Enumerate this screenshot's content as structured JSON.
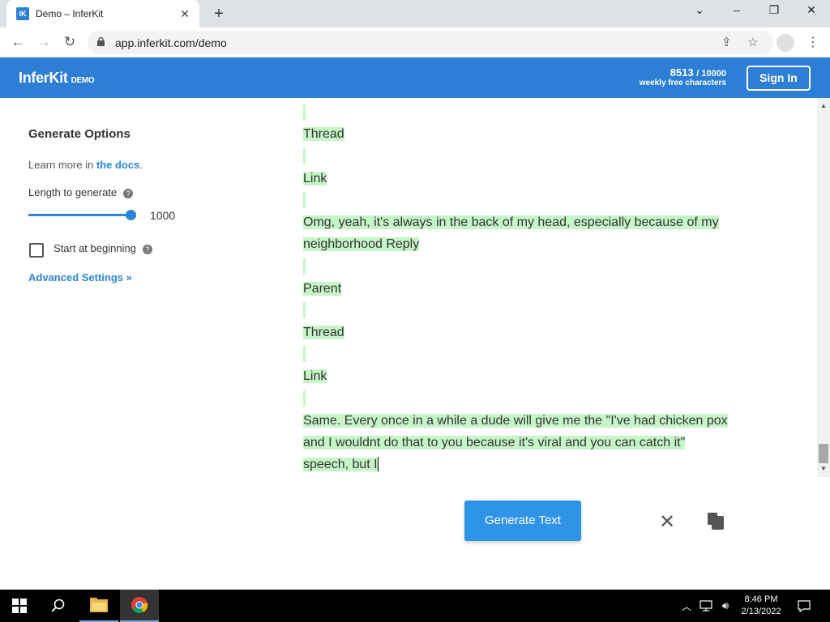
{
  "browser": {
    "tab_title": "Demo – InferKit",
    "tab_favicon": "IK",
    "url": "app.inferkit.com/demo",
    "new_tab_label": "+",
    "tab_close_label": "✕"
  },
  "header": {
    "logo": "InferKit",
    "logo_badge": "DEMO",
    "quota_used": "8513",
    "quota_total": "/ 10000",
    "quota_label": "weekly free characters",
    "signin_label": "Sign In"
  },
  "options": {
    "title": "Generate Options",
    "learn_prefix": "Learn more in ",
    "docs_link": "the docs",
    "learn_suffix": ".",
    "length_label": "Length to generate",
    "length_value": "1000",
    "start_label": "Start at beginning",
    "advanced_label": "Advanced Settings »"
  },
  "text": {
    "line_thread1": "Thread",
    "line_link1": "Link",
    "para1_line1": "Omg, yeah, it's always in the back of my head, especially because of my",
    "para1_line2": "neighborhood Reply",
    "line_parent": "Parent",
    "line_thread2": "Thread",
    "line_link2": "Link",
    "para2_line1": "Same. Every once in a while a dude will give me the \"I've had chicken pox",
    "para2_line2": "and I wouldnt do that to you because it's viral and you can catch it\"",
    "para2_line3": "speech, but I"
  },
  "actions": {
    "generate_label": "Generate Text",
    "clear_label": "✕"
  },
  "taskbar": {
    "time": "8:46 PM",
    "date": "2/13/2022"
  },
  "colors": {
    "brand": "#2d7fd6",
    "highlight": "#c6f5c8",
    "button": "#2f93e8"
  }
}
